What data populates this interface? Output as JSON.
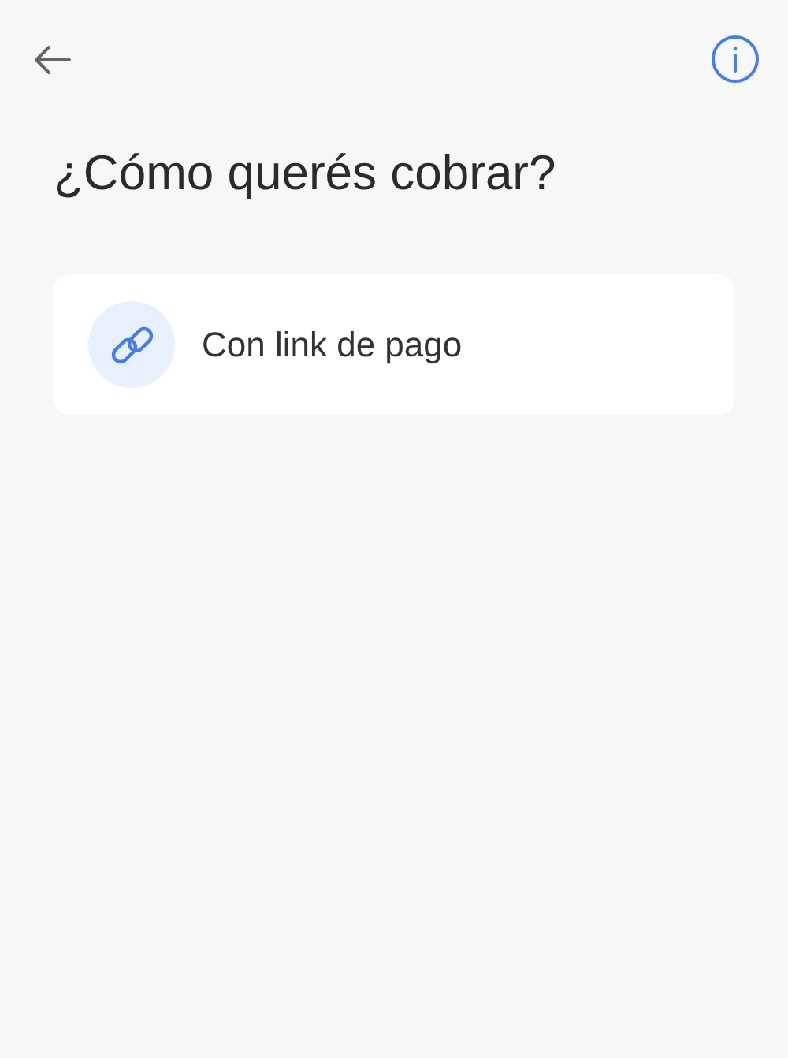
{
  "title": "¿Cómo querés cobrar?",
  "options": [
    {
      "kind": "link",
      "label": "Con link de pago"
    }
  ]
}
